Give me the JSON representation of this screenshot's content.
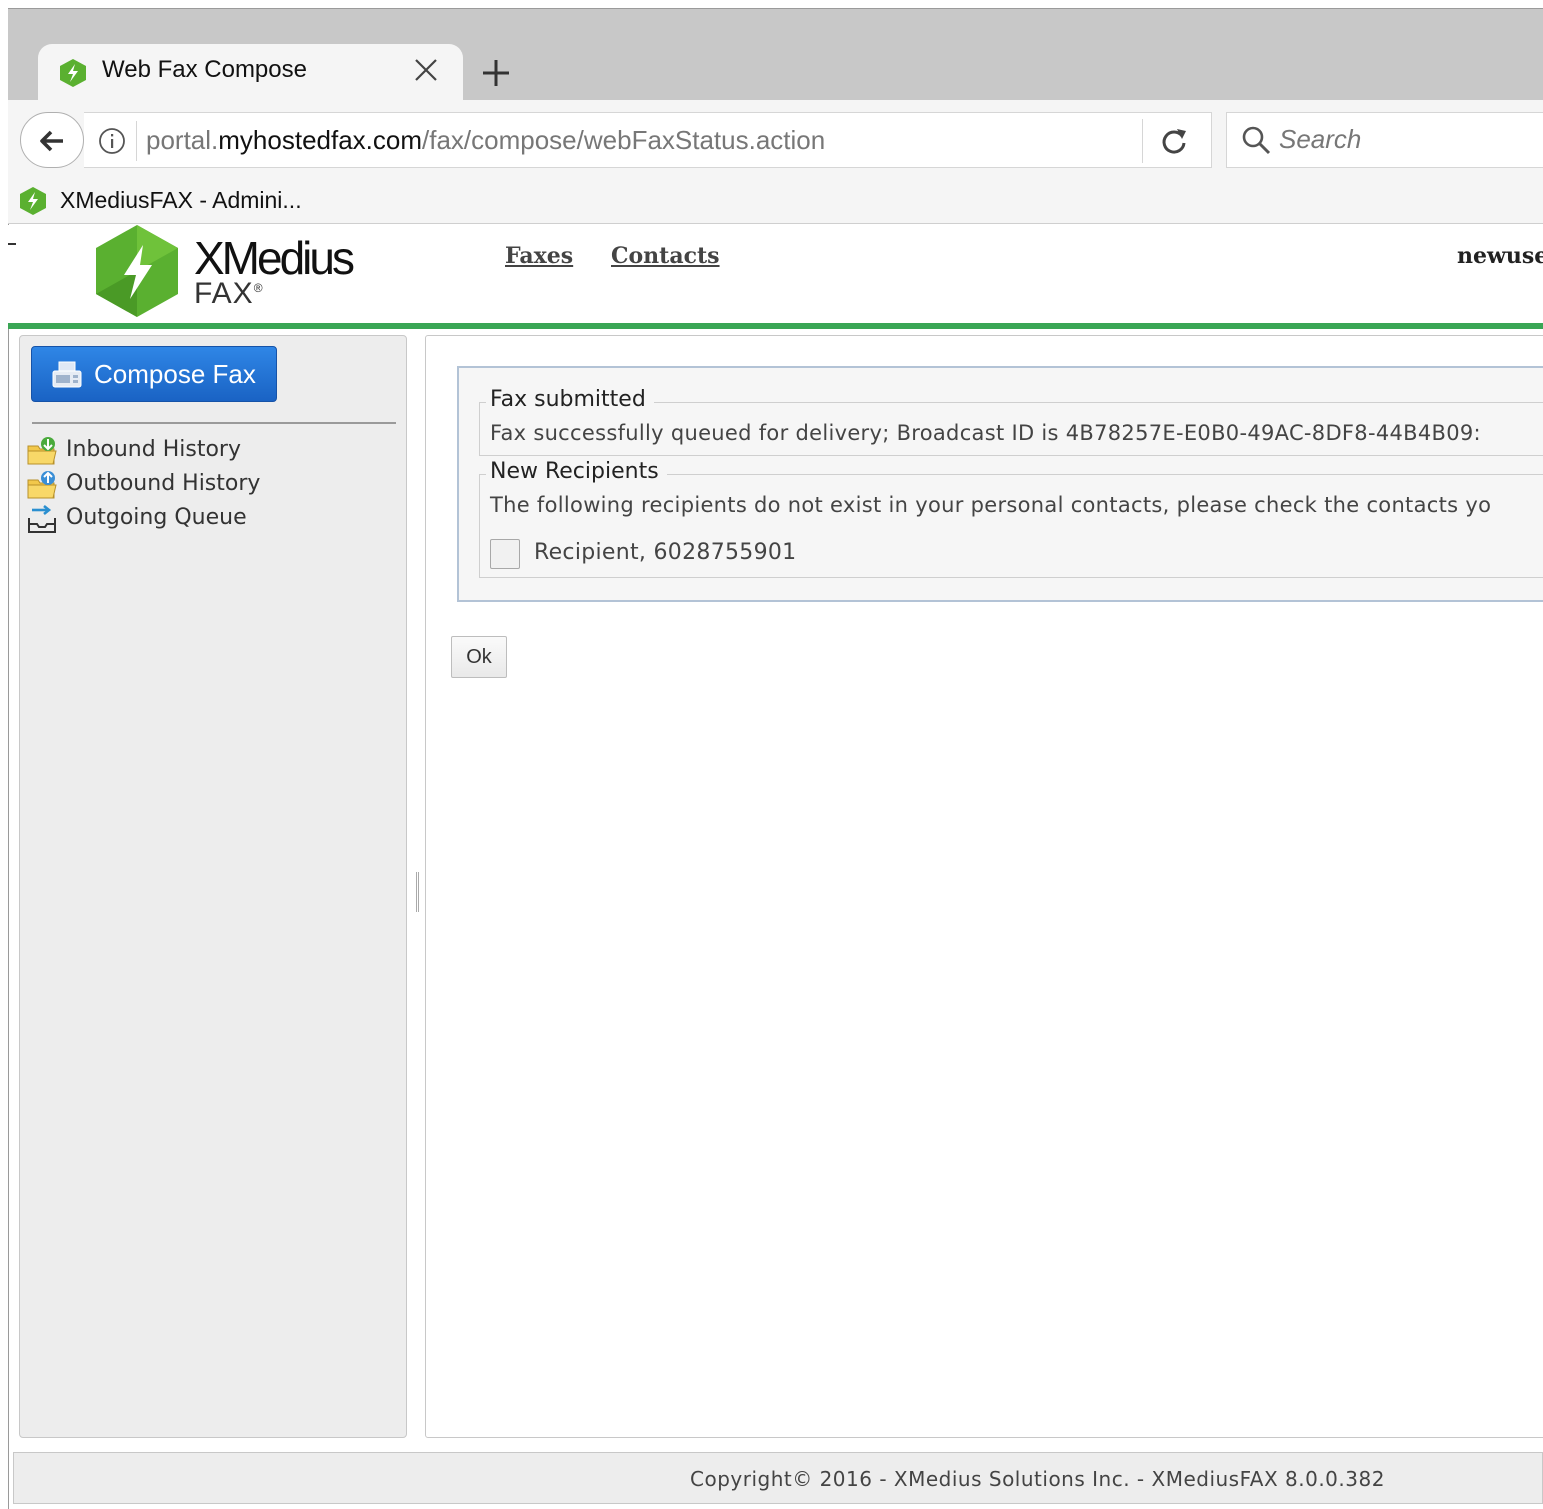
{
  "browser": {
    "tab": {
      "title": "Web Fax Compose",
      "favicon": "xmedius-hex-icon"
    },
    "url": {
      "prefix": "portal.",
      "host": "myhostedfax.com",
      "path": "/fax/compose/webFaxStatus.action"
    },
    "search": {
      "placeholder": "Search"
    },
    "bookmark": {
      "label": "XMediusFAX - Admini..."
    }
  },
  "header": {
    "logo_word": "XMedius",
    "logo_sub": "FAX",
    "logo_reg": "®",
    "nav": {
      "faxes": "Faxes",
      "contacts": "Contacts"
    },
    "username": "newuse"
  },
  "sidebar": {
    "compose_label": "Compose Fax",
    "items": [
      {
        "label": "Inbound History",
        "icon": "inbound-folder-icon"
      },
      {
        "label": "Outbound History",
        "icon": "outbound-folder-icon"
      },
      {
        "label": "Outgoing Queue",
        "icon": "outgoing-queue-icon"
      }
    ]
  },
  "status": {
    "submitted": {
      "legend": "Fax submitted",
      "message": "Fax successfully queued for delivery; Broadcast ID is 4B78257E-E0B0-49AC-8DF8-44B4B09:"
    },
    "recipients": {
      "legend": "New Recipients",
      "message": "The following recipients do not exist in your personal contacts, please check the contacts yo",
      "items": [
        {
          "label": "Recipient,  6028755901",
          "checked": false
        }
      ]
    },
    "ok_label": "Ok"
  },
  "footer": {
    "text": "Copyright© 2016 - XMedius Solutions Inc. - XMediusFAX 8.0.0.382"
  },
  "colors": {
    "accent_green": "#3aa655",
    "compose_blue": "#1f6fd6",
    "logo_green": "#5ab030"
  }
}
